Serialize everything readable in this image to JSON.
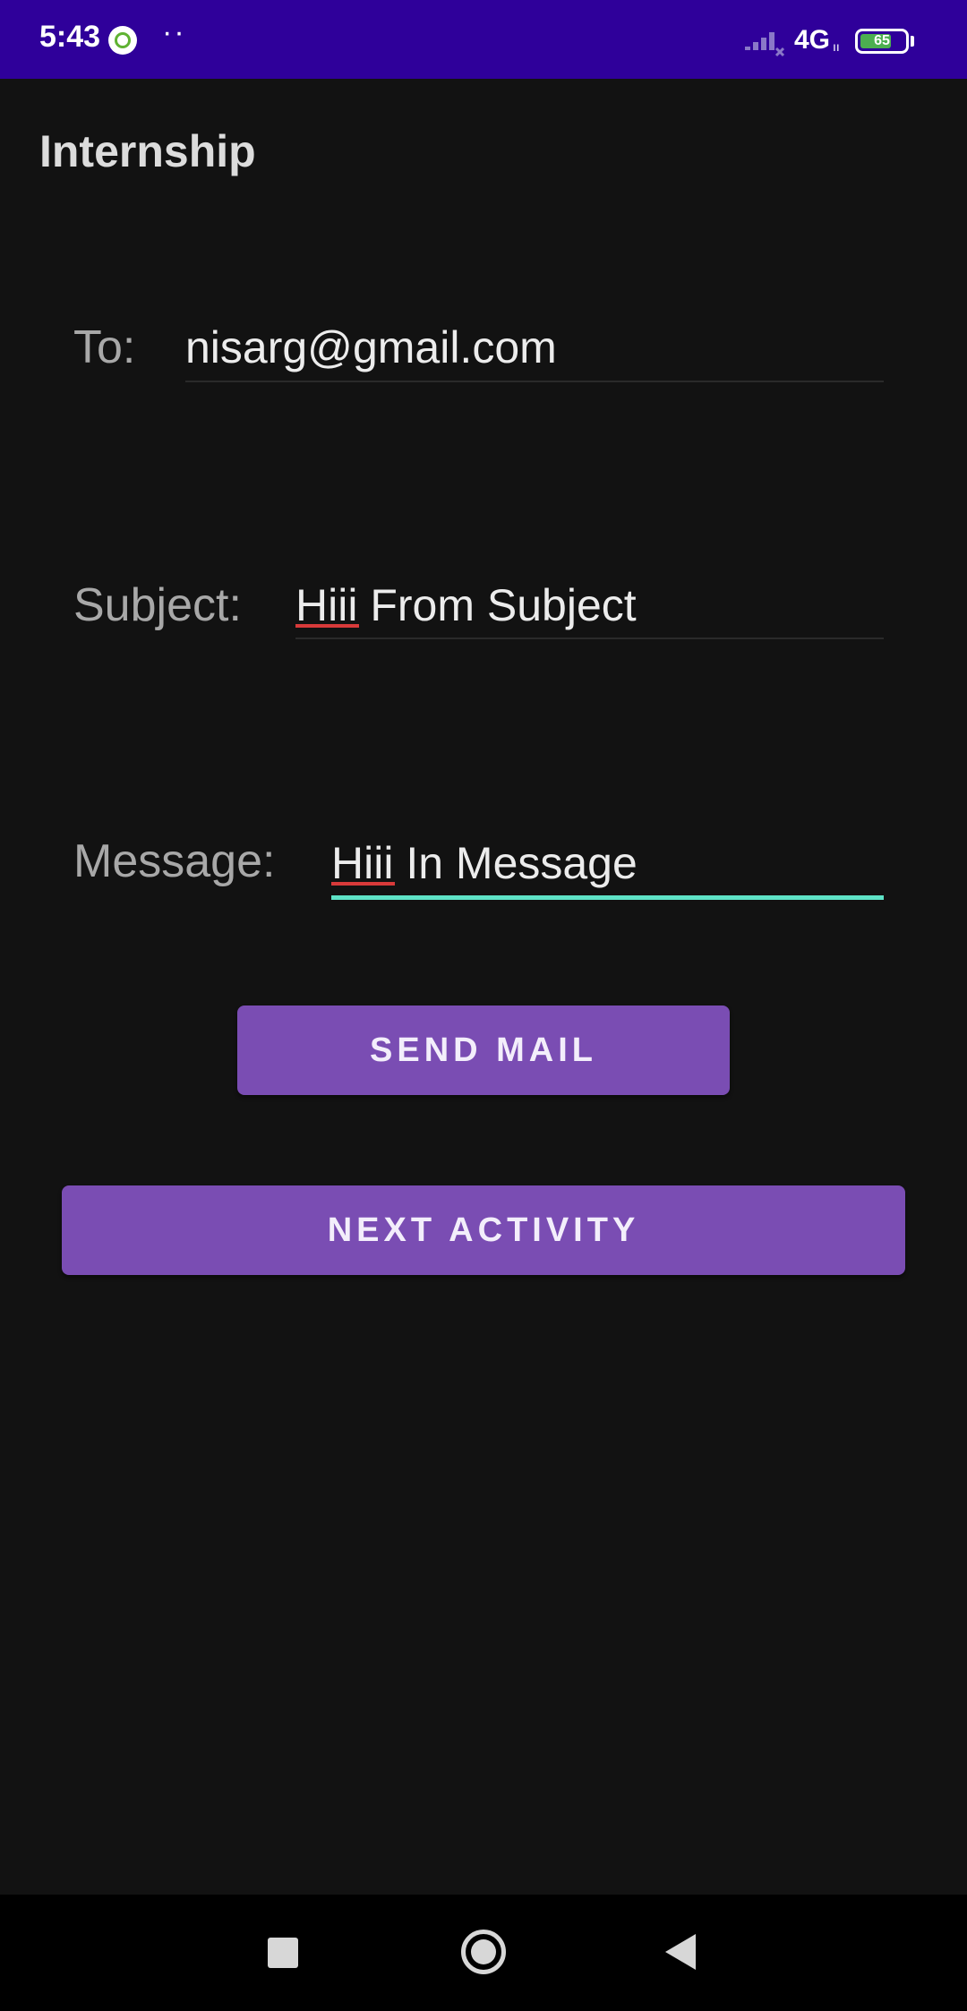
{
  "status_bar": {
    "time": "5:43",
    "dots": "··",
    "network": "4G",
    "network_sub": "ıı",
    "battery_level": "65",
    "icons": [
      "app-notification-icon",
      "signal-icon",
      "battery-icon"
    ],
    "background_color": "#2f009a"
  },
  "app_bar": {
    "title": "Internship"
  },
  "form": {
    "to": {
      "label": "To:",
      "value": "nisarg@gmail.com"
    },
    "subject": {
      "label": "Subject:",
      "value": "Hiii From Subject"
    },
    "message": {
      "label": "Message:",
      "value": "Hiii In Message",
      "focused": true
    }
  },
  "buttons": {
    "send_mail": "SEND MAIL",
    "next_activity": "NEXT ACTIVITY"
  },
  "nav_bar": {
    "items": [
      "recents-icon",
      "home-icon",
      "back-icon"
    ]
  },
  "colors": {
    "accent": "#7a4db3",
    "focus_underline": "#5ee2c6",
    "spellcheck": "#d83a3a",
    "background": "#121212"
  }
}
